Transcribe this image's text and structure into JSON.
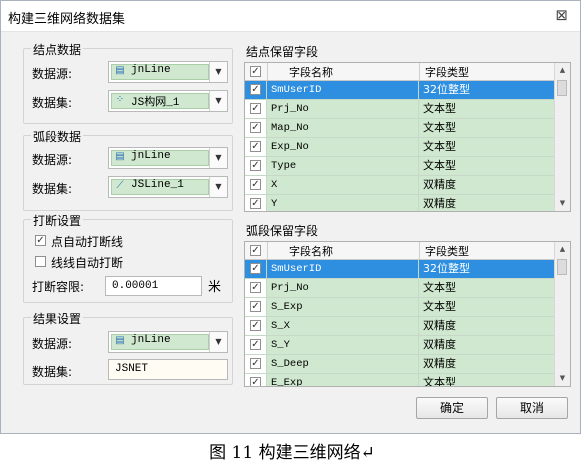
{
  "window": {
    "title": "构建三维网络数据集",
    "close": "⊠"
  },
  "node_group": {
    "title": "结点数据",
    "source_label": "数据源:",
    "source_value": "jnLine",
    "dataset_label": "数据集:",
    "dataset_value": "JS构网_1"
  },
  "arc_group": {
    "title": "弧段数据",
    "source_label": "数据源:",
    "source_value": "jnLine",
    "dataset_label": "数据集:",
    "dataset_value": "JSLine_1"
  },
  "break_group": {
    "title": "打断设置",
    "auto_break_point": "点自动打断线",
    "auto_break_point_checked": true,
    "auto_break_line": "线线自动打断",
    "auto_break_line_checked": false,
    "tolerance_label": "打断容限:",
    "tolerance_value": "0.00001",
    "unit": "米"
  },
  "result_group": {
    "title": "结果设置",
    "source_label": "数据源:",
    "source_value": "jnLine",
    "dataset_label": "数据集:",
    "dataset_value": "JSNET"
  },
  "node_fields": {
    "title": "结点保留字段",
    "col_name": "字段名称",
    "col_type": "字段类型",
    "rows": [
      {
        "name": "SmUserID",
        "type": "32位整型"
      },
      {
        "name": "Prj_No",
        "type": "文本型"
      },
      {
        "name": "Map_No",
        "type": "文本型"
      },
      {
        "name": "Exp_No",
        "type": "文本型"
      },
      {
        "name": "Type",
        "type": "文本型"
      },
      {
        "name": "X",
        "type": "双精度"
      },
      {
        "name": "Y",
        "type": "双精度"
      }
    ]
  },
  "arc_fields": {
    "title": "弧段保留字段",
    "col_name": "字段名称",
    "col_type": "字段类型",
    "rows": [
      {
        "name": "SmUserID",
        "type": "32位整型"
      },
      {
        "name": "Prj_No",
        "type": "文本型"
      },
      {
        "name": "S_Exp",
        "type": "文本型"
      },
      {
        "name": "S_X",
        "type": "双精度"
      },
      {
        "name": "S_Y",
        "type": "双精度"
      },
      {
        "name": "S_Deep",
        "type": "双精度"
      },
      {
        "name": "E_Exp",
        "type": "文本型"
      }
    ]
  },
  "buttons": {
    "ok": "确定",
    "cancel": "取消"
  },
  "caption": "图 11 构建三维网络↵"
}
